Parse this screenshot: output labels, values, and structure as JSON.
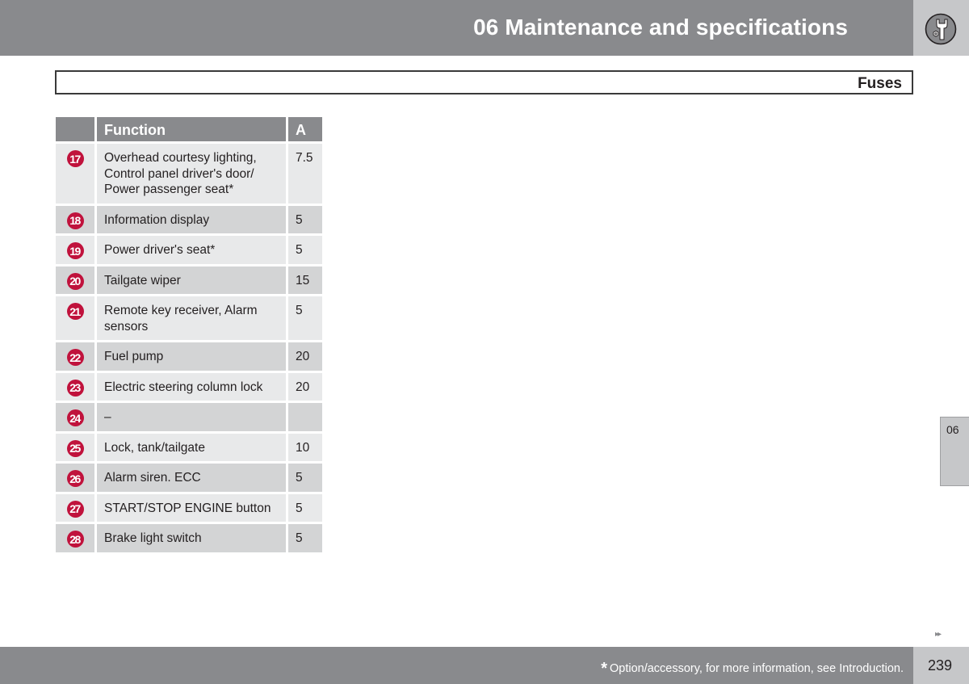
{
  "header": {
    "chapter_title": "06 Maintenance and specifications",
    "chapter_icon": "wrench-nut-icon"
  },
  "section": {
    "title": "Fuses"
  },
  "table": {
    "columns": [
      "",
      "Function",
      "A"
    ],
    "rows": [
      {
        "number": "17",
        "function": "Overhead courtesy lighting, Control panel driver's door/ Power passenger seat*",
        "amps": "7.5"
      },
      {
        "number": "18",
        "function": "Information display",
        "amps": "5"
      },
      {
        "number": "19",
        "function": "Power driver's seat*",
        "amps": "5"
      },
      {
        "number": "20",
        "function": "Tailgate wiper",
        "amps": "15"
      },
      {
        "number": "21",
        "function": "Remote key receiver, Alarm sensors",
        "amps": "5"
      },
      {
        "number": "22",
        "function": "Fuel pump",
        "amps": "20"
      },
      {
        "number": "23",
        "function": "Electric steering column lock",
        "amps": "20"
      },
      {
        "number": "24",
        "function": "–",
        "amps": ""
      },
      {
        "number": "25",
        "function": "Lock, tank/tailgate",
        "amps": "10"
      },
      {
        "number": "26",
        "function": "Alarm siren. ECC",
        "amps": "5"
      },
      {
        "number": "27",
        "function": "START/STOP ENGINE button",
        "amps": "5"
      },
      {
        "number": "28",
        "function": "Brake light switch",
        "amps": "5"
      }
    ]
  },
  "chapter_tab": {
    "label": "06"
  },
  "next_page_indicator": "▸▸",
  "footer": {
    "asterisk": "*",
    "note": "Option/accessory, for more information, see Introduction.",
    "page_number": "239"
  },
  "colors": {
    "header_gray": "#898a8d",
    "tab_gray": "#c6c7c9",
    "badge_red": "#c0123c",
    "row_light": "#e8e9ea",
    "row_dark": "#d3d4d5"
  }
}
